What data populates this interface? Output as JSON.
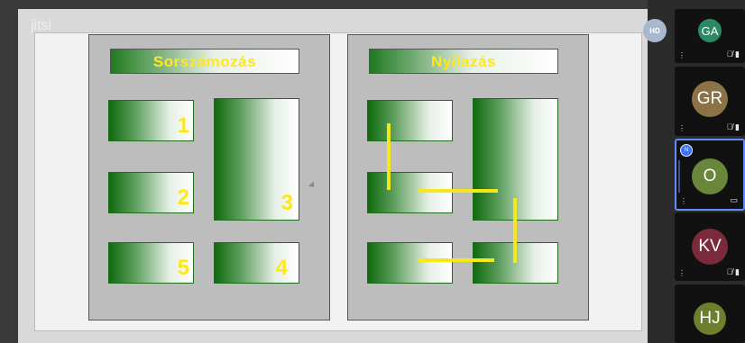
{
  "brand": {
    "text": "jitsi"
  },
  "slide": {
    "left_title": "Sorszámozás",
    "right_title": "Nyilazás",
    "numbers": [
      "1",
      "2",
      "3",
      "5",
      "4"
    ]
  },
  "presenter_badge": "HD",
  "participants": [
    {
      "initials": "GA",
      "color": "#2b8a66"
    },
    {
      "initials": "GR",
      "color": "#8b7347"
    },
    {
      "initials": "O",
      "color": "#69873a",
      "active": true
    },
    {
      "initials": "KV",
      "color": "#7b2a3b"
    },
    {
      "initials": "HJ",
      "color": "#6b7f2c"
    }
  ],
  "tile_icons": [
    "mic-muted-icon",
    "camera-muted-icon",
    "screen-share-icon"
  ],
  "colors": {
    "accent": "#ffe81a",
    "green": "#1f7a1f"
  }
}
